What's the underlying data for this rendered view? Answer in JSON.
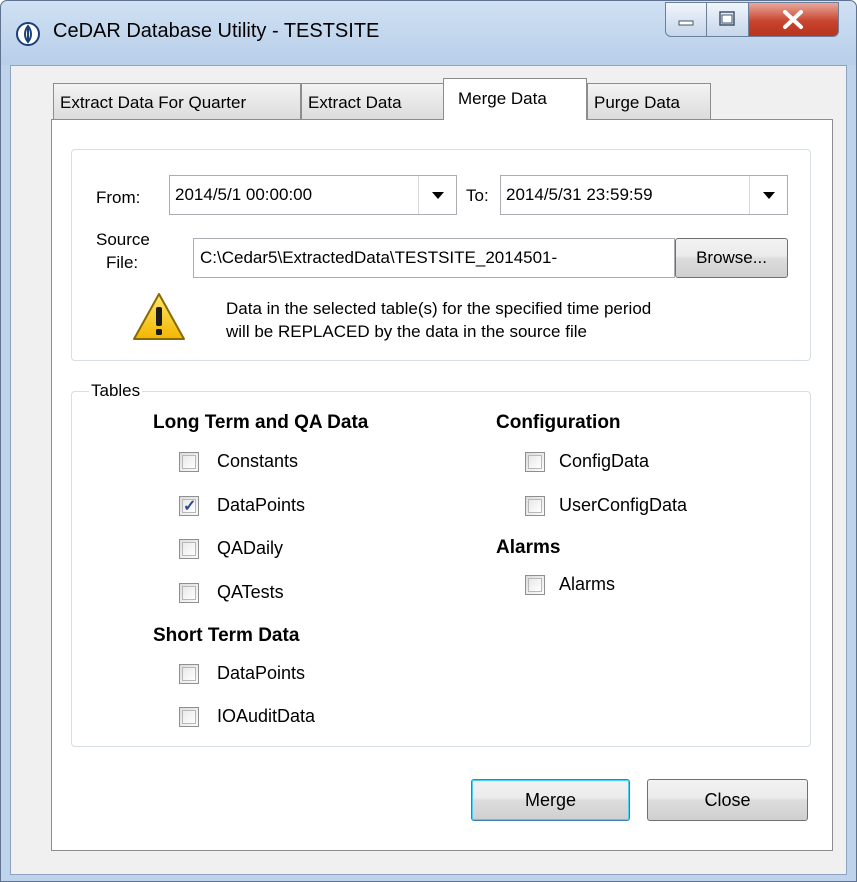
{
  "window": {
    "title": "CeDAR Database Utility - TESTSITE"
  },
  "tabs": [
    {
      "label": "Extract Data For Quarter"
    },
    {
      "label": "Extract Data"
    },
    {
      "label": "Merge Data"
    },
    {
      "label": "Purge Data"
    }
  ],
  "active_tab": "Merge Data",
  "range": {
    "from_label": "From:",
    "from_value": "2014/5/1 00:00:00",
    "to_label": "To:",
    "to_value": "2014/5/31 23:59:59"
  },
  "source": {
    "label_line1": "Source",
    "label_line2": "File:",
    "value": "C:\\Cedar5\\ExtractedData\\TESTSITE_2014501-",
    "browse_label": "Browse..."
  },
  "warning": {
    "line1": "Data in the selected table(s) for the specified time period",
    "line2": "will be REPLACED by the data in the source file",
    "icon": "warning-icon"
  },
  "tables": {
    "group_title": "Tables",
    "long_term_header": "Long Term and QA Data",
    "long_term": [
      {
        "label": "Constants",
        "checked": false
      },
      {
        "label": "DataPoints",
        "checked": true
      },
      {
        "label": "QADaily",
        "checked": false
      },
      {
        "label": "QATests",
        "checked": false
      }
    ],
    "short_term_header": "Short Term Data",
    "short_term": [
      {
        "label": "DataPoints",
        "checked": false
      },
      {
        "label": "IOAuditData",
        "checked": false
      }
    ],
    "configuration_header": "Configuration",
    "configuration": [
      {
        "label": "ConfigData",
        "checked": false
      },
      {
        "label": "UserConfigData",
        "checked": false
      }
    ],
    "alarms_header": "Alarms",
    "alarms": [
      {
        "label": "Alarms",
        "checked": false
      }
    ]
  },
  "buttons": {
    "merge": "Merge",
    "close": "Close"
  },
  "colors": {
    "accent": "#3c7fb1",
    "warning_yellow": "#f5c400"
  }
}
